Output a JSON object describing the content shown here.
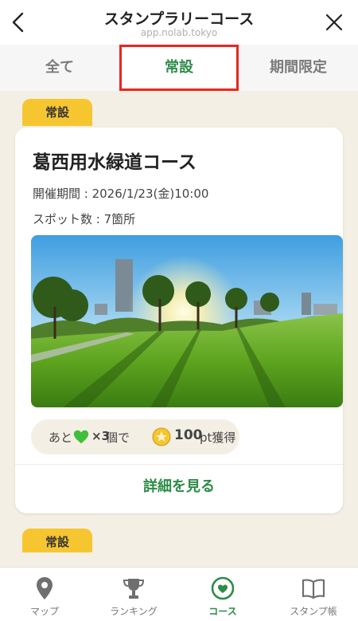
{
  "header": {
    "title": "スタンプラリーコース",
    "subtitle": "app.nolab.tokyo"
  },
  "tabs": [
    {
      "label": "全て",
      "active": false
    },
    {
      "label": "常設",
      "active": true
    },
    {
      "label": "期間限定",
      "active": false
    }
  ],
  "courses": [
    {
      "badge": "常設",
      "title": "葛西用水緑道コース",
      "period": "開催期間 : 2026/1/23(金)10:00",
      "spots": "スポット数 : 7箇所",
      "reward": {
        "prefix": "あと",
        "multiplier": "×3",
        "unit": "個で",
        "points": "100",
        "points_suffix": "pt獲得"
      },
      "detail_label": "詳細を見る"
    },
    {
      "badge": "常設"
    }
  ],
  "nav": [
    {
      "label": "マップ",
      "icon": "map-pin-icon",
      "active": false
    },
    {
      "label": "ランキング",
      "icon": "trophy-icon",
      "active": false
    },
    {
      "label": "コース",
      "icon": "heart-circle-icon",
      "active": true
    },
    {
      "label": "スタンプ帳",
      "icon": "book-icon",
      "active": false
    }
  ],
  "colors": {
    "accent_green": "#2d8c48",
    "badge_yellow": "#f6c631",
    "highlight_red": "#e9261f",
    "background": "#f4efe4"
  }
}
